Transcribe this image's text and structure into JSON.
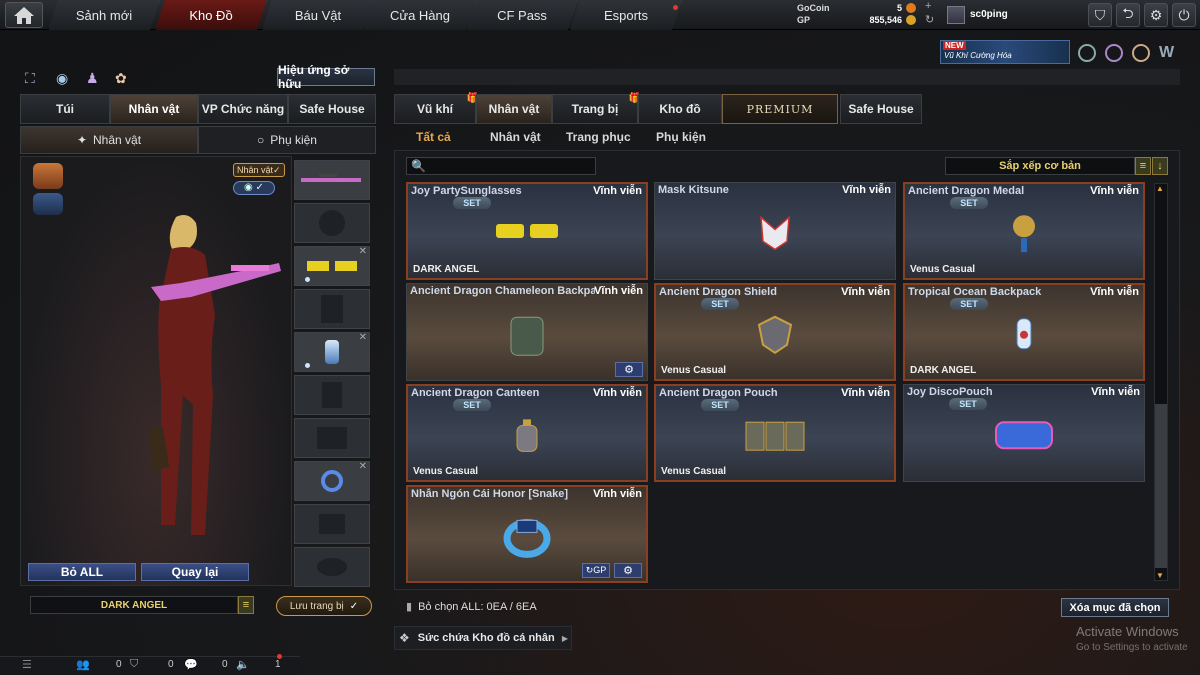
{
  "nav": {
    "tabs": [
      {
        "label": "Sảnh mới"
      },
      {
        "label": "Kho Đồ"
      },
      {
        "label": "Báu Vật"
      },
      {
        "label": "Cửa Hàng"
      },
      {
        "label": "CF Pass"
      },
      {
        "label": "Esports"
      }
    ]
  },
  "currency": {
    "gocoin_label": "GoCoin",
    "gocoin_value": "5",
    "gp_label": "GP",
    "gp_value": "855,546"
  },
  "user": {
    "name": "sc0ping"
  },
  "banner": {
    "badge": "NEW",
    "text": "Vũ Khí Cường Hóa"
  },
  "left": {
    "effects_button": "Hiệu ứng sở hữu",
    "tabs": [
      {
        "label": "Túi"
      },
      {
        "label": "Nhân vật"
      },
      {
        "label": "VP Chức năng"
      },
      {
        "label": "Safe House"
      }
    ],
    "subtabs": [
      {
        "label": "Nhân vật"
      },
      {
        "label": "Phụ kiện"
      }
    ],
    "char_badge": "Nhân vật",
    "remove_all": "Bỏ ALL",
    "back": "Quay lại",
    "preset_name": "DARK ANGEL",
    "save_button": "Lưu trang bị"
  },
  "right": {
    "tabs": [
      {
        "label": "Vũ khí"
      },
      {
        "label": "Nhân vật"
      },
      {
        "label": "Trang bị"
      },
      {
        "label": "Kho đồ"
      },
      {
        "label": "PREMIUM"
      },
      {
        "label": "Safe House"
      }
    ],
    "filters": [
      {
        "label": "Tất cả"
      },
      {
        "label": "Nhân vật"
      },
      {
        "label": "Trang phục"
      },
      {
        "label": "Phụ kiện"
      }
    ],
    "search_placeholder": "",
    "sort_label": "Sắp xếp cơ bản",
    "selection_status": "Bỏ chọn ALL: 0EA / 6EA",
    "delete_button": "Xóa mục đã chọn",
    "storage_label": "Sức chứa Kho đồ cá nhân"
  },
  "items": [
    {
      "name": "Joy PartySunglasses",
      "perm": "Vĩnh viễn",
      "set": "SET",
      "footer": "DARK ANGEL"
    },
    {
      "name": "Mask Kitsune",
      "perm": "Vĩnh viễn",
      "set": "",
      "footer": ""
    },
    {
      "name": "Ancient Dragon Medal",
      "perm": "Vĩnh viễn",
      "set": "SET",
      "footer": "Venus Casual"
    },
    {
      "name": "Ancient Dragon Chameleon Backpack",
      "perm": "Vĩnh viễn",
      "set": "",
      "footer": ""
    },
    {
      "name": "Ancient Dragon Shield",
      "perm": "Vĩnh viễn",
      "set": "SET",
      "footer": "Venus Casual"
    },
    {
      "name": "Tropical Ocean Backpack",
      "perm": "Vĩnh viễn",
      "set": "SET",
      "footer": "DARK ANGEL"
    },
    {
      "name": "Ancient Dragon Canteen",
      "perm": "Vĩnh viễn",
      "set": "SET",
      "footer": "Venus Casual"
    },
    {
      "name": "Ancient Dragon Pouch",
      "perm": "Vĩnh viễn",
      "set": "SET",
      "footer": "Venus Casual"
    },
    {
      "name": "Joy DiscoPouch",
      "perm": "Vĩnh viễn",
      "set": "SET",
      "footer": ""
    },
    {
      "name": "Nhẫn Ngón Cái Honor [Snake]",
      "perm": "Vĩnh viễn",
      "set": "",
      "footer": ""
    }
  ],
  "bottom": {
    "c1": "0",
    "c2": "0",
    "c3": "0",
    "c4": "1"
  },
  "watermark": {
    "title": "Activate Windows",
    "sub": "Go to Settings to activate"
  },
  "colors": {
    "accent": "#e8a84a",
    "active_tab": "#6a1a16",
    "set_border": "#8a4020",
    "button_blue": "#2d3d6e"
  }
}
